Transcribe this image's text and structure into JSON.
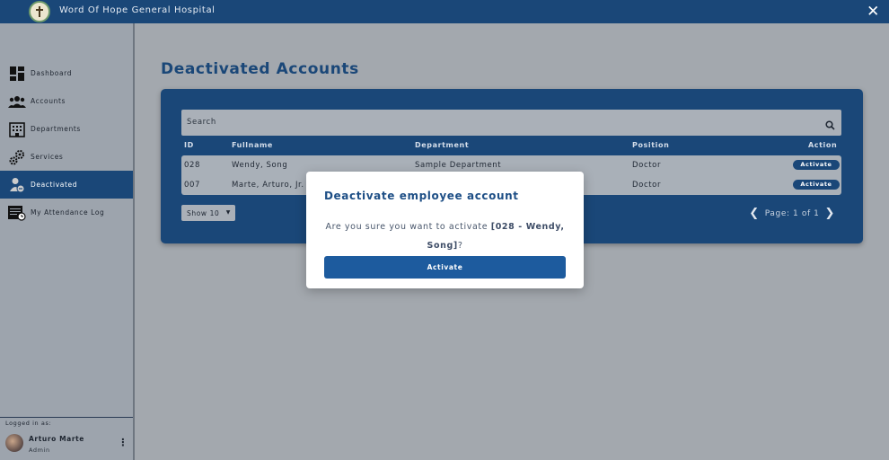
{
  "app": {
    "title": "Word Of Hope General Hospital",
    "close": "✕"
  },
  "sidebar": {
    "items": [
      {
        "label": "Dashboard",
        "icon": "dashboard-icon"
      },
      {
        "label": "Accounts",
        "icon": "users-icon"
      },
      {
        "label": "Departments",
        "icon": "building-icon"
      },
      {
        "label": "Services",
        "icon": "gears-icon"
      },
      {
        "label": "Deactivated",
        "icon": "user-deactivated-icon",
        "active": true
      },
      {
        "label": "My Attendance Log",
        "icon": "calendar-clock-icon"
      }
    ],
    "footer": {
      "logged_in_label": "Logged in as:",
      "user_name": "Arturo Marte",
      "user_role": "Admin",
      "menu": "⋮"
    }
  },
  "main": {
    "title": "Deactivated Accounts",
    "search": {
      "placeholder": "Search"
    },
    "columns": [
      "ID",
      "Fullname",
      "Department",
      "Position",
      "Action"
    ],
    "rows": [
      {
        "id": "028",
        "fullname": "Wendy, Song",
        "department": "Sample Department",
        "position": "Doctor",
        "action": "Activate"
      },
      {
        "id": "007",
        "fullname": "Marte, Arturo, Jr.",
        "department": "",
        "position": "Doctor",
        "action": "Activate"
      }
    ],
    "show": {
      "label": "Show 10",
      "arrow": "▼"
    },
    "pager": {
      "text": "Page: 1 of 1",
      "prev": "❮",
      "next": "❯"
    }
  },
  "modal": {
    "title": "Deactivate employee account",
    "text_before": "Are you sure you want to activate ",
    "target": "[028 - Wendy, Song]",
    "text_after": "?",
    "button": "Activate"
  },
  "colors": {
    "brand": "#1a4778",
    "button": "#1d5b9e",
    "overlay": "#a3a8ae"
  }
}
